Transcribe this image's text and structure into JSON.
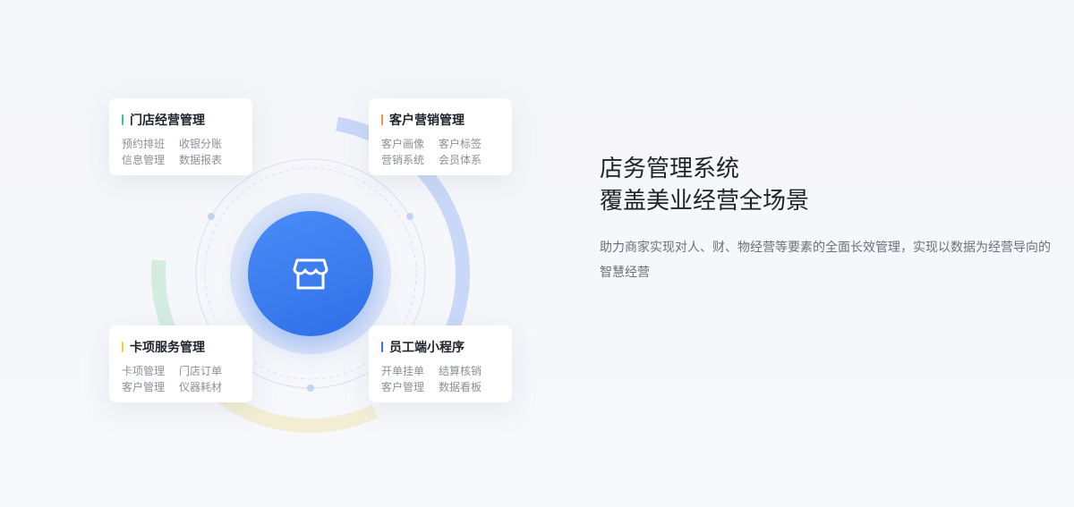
{
  "cards": [
    {
      "title": "门店经营管理",
      "accent": "#3cc18a",
      "items": [
        "预约排班",
        "收银分账",
        "信息管理",
        "数据报表"
      ]
    },
    {
      "title": "客户营销管理",
      "accent": "#f5923e",
      "items": [
        "客户画像",
        "客户标签",
        "营销系统",
        "会员体系"
      ]
    },
    {
      "title": "卡项服务管理",
      "accent": "#f7cf3b",
      "items": [
        "卡项管理",
        "门店订单",
        "客户管理",
        "仪器耗材"
      ]
    },
    {
      "title": "员工端小程序",
      "accent": "#3b6ef5",
      "items": [
        "开单挂单",
        "结算核销",
        "客户管理",
        "数据看板"
      ]
    }
  ],
  "center_icon": "store-icon",
  "headline_line1": "店务管理系统",
  "headline_line2": "覆盖美业经营全场景",
  "description": "助力商家实现对人、财、物经营等要素的全面长效管理，实现以数据为经营导向的智慧经营",
  "colors": {
    "primary": "#2f6fe8",
    "ring_green": "#cfeadc",
    "ring_blue": "#c7d6f7",
    "ring_yellow": "#f3eccb"
  }
}
